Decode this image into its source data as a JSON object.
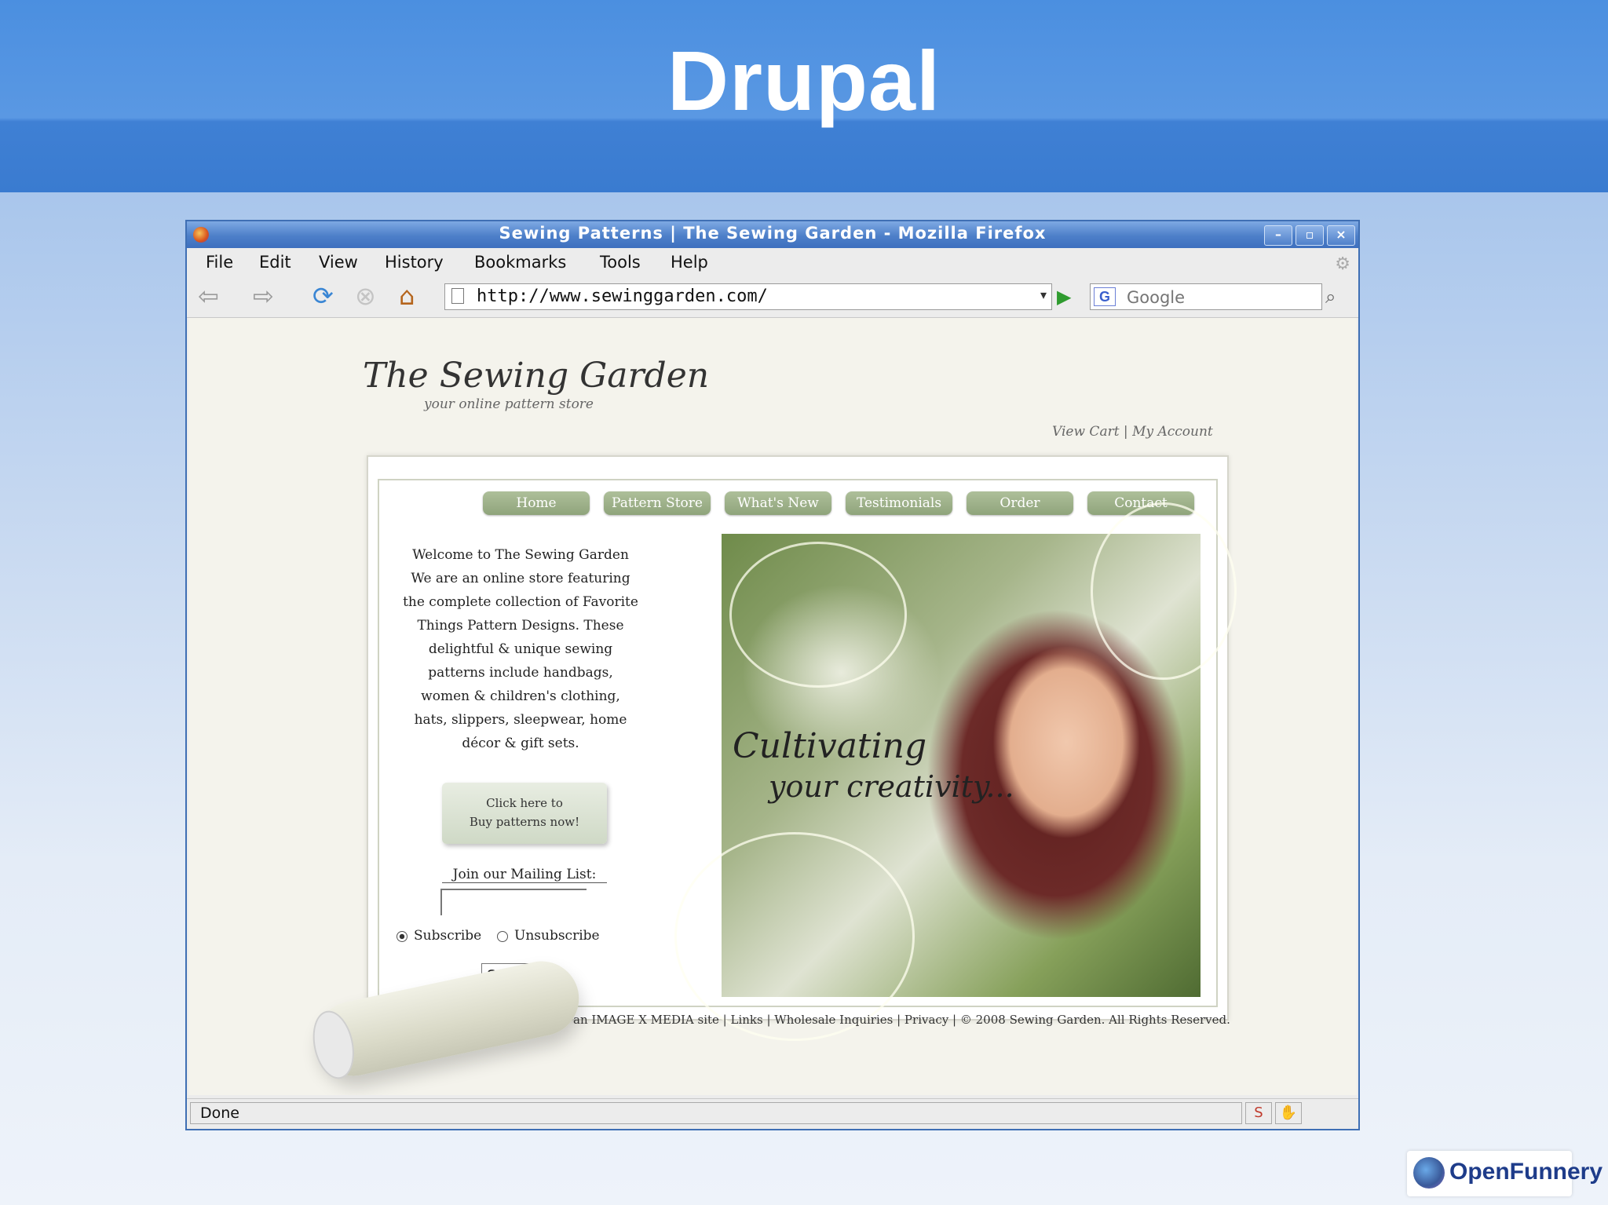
{
  "slide": {
    "title": "Drupal"
  },
  "window": {
    "title": "Sewing Patterns | The Sewing Garden - Mozilla Firefox",
    "min": "–",
    "max": "▫",
    "close": "×"
  },
  "menu": [
    "File",
    "Edit",
    "View",
    "History",
    "Bookmarks",
    "Tools",
    "Help"
  ],
  "address": {
    "url": "http://www.sewinggarden.com/"
  },
  "search": {
    "engine_icon": "G",
    "placeholder": "Google"
  },
  "icons": {
    "back": "back-arrow-icon",
    "forward": "forward-arrow-icon",
    "reload": "reload-icon",
    "stop": "stop-icon",
    "home": "home-icon",
    "go": "go-arrow-icon",
    "search": "magnifier-icon"
  },
  "site": {
    "logo": "The Sewing Garden",
    "tagline": "your online pattern store",
    "account_links": "View Cart | My Account",
    "nav": [
      "Home",
      "Pattern Store",
      "What's New",
      "Testimonials",
      "Order",
      "Contact"
    ],
    "welcome_title": "Welcome to The Sewing Garden",
    "welcome_body": "We are an online store featuring the complete collection of Favorite Things Pattern Designs. These delightful & unique sewing patterns include handbags, women & children's clothing, hats, slippers, sleepwear, home décor & gift sets.",
    "buy_line1": "Click here to",
    "buy_line2": "Buy patterns now!",
    "mailing_label": "Join our Mailing List:",
    "subscribe": "Subscribe",
    "unsubscribe": "Unsubscribe",
    "submit": "Submit",
    "hero_line1": "Cultivating",
    "hero_line2": "your creativity...",
    "footer": "an IMAGE X MEDIA site | Links | Wholesale Inquiries | Privacy | © 2008 Sewing Garden. All Rights Reserved."
  },
  "status": {
    "text": "Done"
  },
  "brand": {
    "text": "OpenFunnery"
  }
}
